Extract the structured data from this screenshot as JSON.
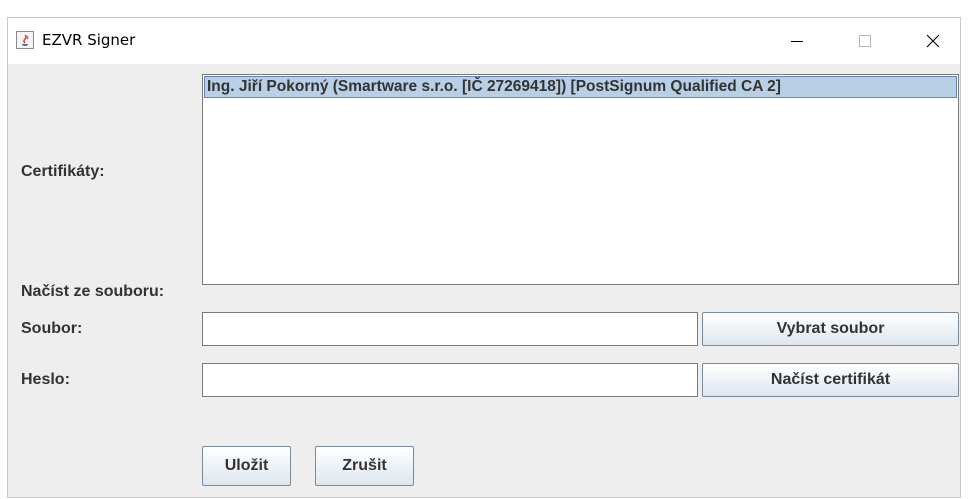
{
  "window": {
    "title": "EZVR Signer"
  },
  "labels": {
    "certificates": "Certifikáty:",
    "load_from_file": "Načíst ze souboru:",
    "file": "Soubor:",
    "password": "Heslo:"
  },
  "certificates": {
    "items": [
      "Ing. Jiří Pokorný (Smartware s.r.o. [IČ 27269418]) [PostSignum Qualified CA 2]"
    ],
    "selected_index": 0
  },
  "inputs": {
    "file_value": "",
    "password_value": ""
  },
  "buttons": {
    "choose_file": "Vybrat soubor",
    "load_certificate": "Načíst certifikát",
    "save": "Uložit",
    "cancel": "Zrušit"
  },
  "colors": {
    "selection_bg": "#b8cfe5",
    "selection_border": "#6382bf",
    "panel_bg": "#eeeeee"
  },
  "icons": {
    "app": "java-cup-icon",
    "minimize": "minimize-icon",
    "maximize": "maximize-icon",
    "close": "close-icon"
  }
}
